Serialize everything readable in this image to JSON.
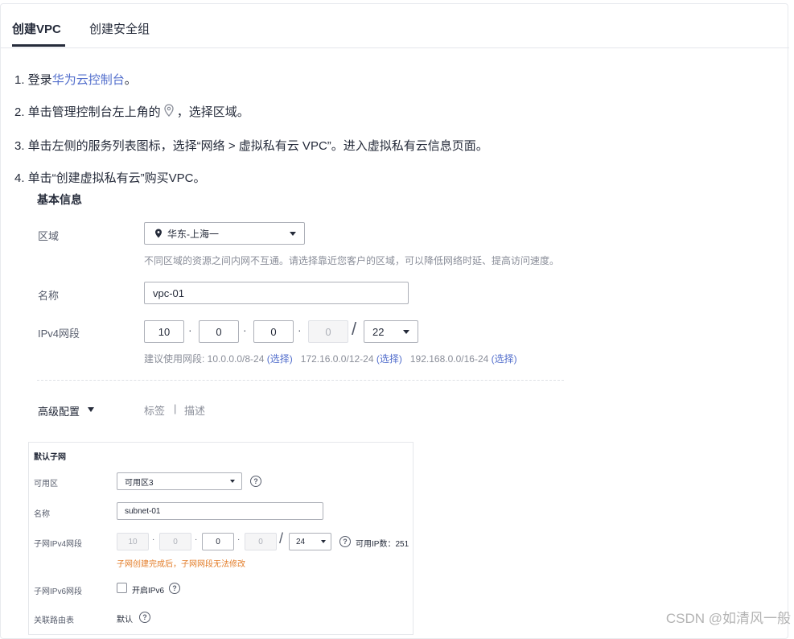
{
  "tabs": [
    {
      "label": "创建VPC",
      "active": true
    },
    {
      "label": "创建安全组",
      "active": false
    }
  ],
  "steps": {
    "s1_prefix": "1. 登录",
    "s1_link": "华为云控制台",
    "s1_suffix": "。",
    "s2_prefix": "2. 单击管理控制台左上角的",
    "s2_suffix": "，选择区域。",
    "s3": "3. 单击左侧的服务列表图标，选择“网络 > 虚拟私有云 VPC”。进入虚拟私有云信息页面。",
    "s4": "4. 单击“创建虚拟私有云”购买VPC。"
  },
  "basic": {
    "title": "基本信息",
    "region_label": "区域",
    "region_value": "华东-上海一",
    "region_hint": "不同区域的资源之间内网不互通。请选择靠近您客户的区域，可以降低网络时延、提高访问速度。",
    "name_label": "名称",
    "name_value": "vpc-01",
    "ipv4_label": "IPv4网段",
    "ip": [
      "10",
      "0",
      "0",
      "0"
    ],
    "mask": "22",
    "suggest_prefix": "建议使用网段: 10.0.0.0/8-24",
    "suggest_2": "172.16.0.0/12-24",
    "suggest_3": "192.168.0.0/16-24",
    "select_link": "(选择)"
  },
  "advanced": {
    "label": "高级配置",
    "tag": "标签",
    "separator": "|",
    "desc": "描述"
  },
  "subnet": {
    "title": "默认子网",
    "az_label": "可用区",
    "az_value": "可用区3",
    "name_label": "名称",
    "name_value": "subnet-01",
    "ipv4_label": "子网IPv4网段",
    "ip": [
      "10",
      "0",
      "0",
      "0"
    ],
    "mask": "24",
    "available_ip": "可用IP数：251",
    "warning": "子网创建完成后，子网网段无法修改",
    "ipv6_label": "子网IPv6网段",
    "ipv6_checkbox": "开启IPv6",
    "route_label": "关联路由表",
    "route_value": "默认"
  },
  "watermark": "CSDN @如清风一般",
  "colors": {
    "link": "#526ecc",
    "warning": "#e37d29",
    "text": "#252b3a"
  }
}
